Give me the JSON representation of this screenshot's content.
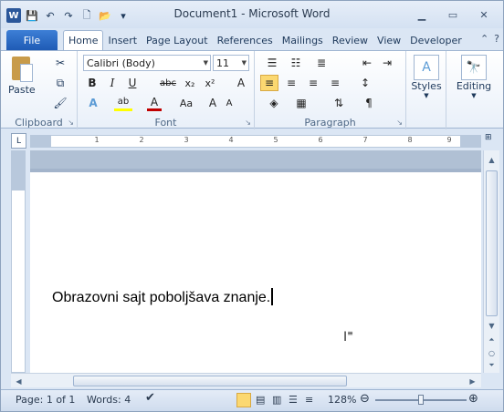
{
  "titlebar": {
    "title": "Document1 - Microsoft Word",
    "app_icon": "W",
    "minimize": "▁",
    "restore": "▭",
    "close": "✕"
  },
  "qat": {
    "save": "💾",
    "undo": "↶",
    "redo": "↷",
    "new": "🗋",
    "open": "📂",
    "customize": "▾"
  },
  "tabs": {
    "file": "File",
    "items": [
      "Home",
      "Insert",
      "Page Layout",
      "References",
      "Mailings",
      "Review",
      "View",
      "Developer"
    ],
    "active": "Home",
    "minimize_ribbon": "⌃",
    "help": "?"
  },
  "ribbon": {
    "clipboard": {
      "label": "Clipboard",
      "paste": "Paste"
    },
    "font": {
      "label": "Font",
      "name": "Calibri (Body)",
      "size": "11",
      "bold": "B",
      "italic": "I",
      "underline": "U",
      "strike": "abc",
      "subscript": "x₂",
      "superscript": "x²",
      "grow": "A",
      "shrink": "A",
      "case": "Aa",
      "clear": "A",
      "text_effects": "A",
      "highlight": "ab",
      "font_color": "A"
    },
    "paragraph": {
      "label": "Paragraph",
      "show_marks": "¶"
    },
    "styles": {
      "label": "Styles"
    },
    "editing": {
      "label": "Editing"
    }
  },
  "ruler": {
    "tab_selector": "L",
    "ticks": [
      "1",
      "2",
      "3",
      "4",
      "5",
      "6",
      "7",
      "8",
      "9"
    ]
  },
  "document": {
    "text": "Obrazovni sajt poboljšava znanje."
  },
  "status": {
    "page": "Page: 1 of 1",
    "words": "Words: 4",
    "zoom": "128%",
    "zoom_fraction": 0.5
  },
  "colors": {
    "file_tab": "#2b62b8",
    "ribbon_bg": "#dbe6f4",
    "font_color_bar": "#c00000",
    "highlight_bar": "#ffff00"
  }
}
